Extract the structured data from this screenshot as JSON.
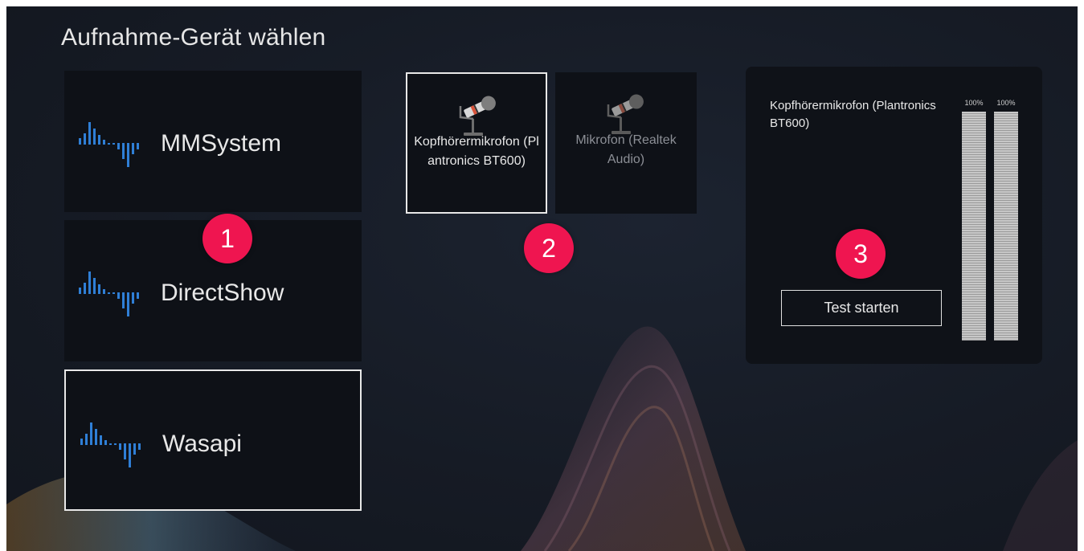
{
  "page": {
    "title": "Aufnahme-Gerät wählen"
  },
  "api_list": [
    {
      "label": "MMSystem",
      "selected": false,
      "icon": "audio-waveform-icon"
    },
    {
      "label": "DirectShow",
      "selected": false,
      "icon": "audio-waveform-icon"
    },
    {
      "label": "Wasapi",
      "selected": true,
      "icon": "audio-waveform-icon"
    }
  ],
  "devices": [
    {
      "label": "Kopfhörermikrofon (Plantronics BT600)",
      "selected": true,
      "icon": "microphone-icon"
    },
    {
      "label": "Mikrofon (Realtek Audio)",
      "selected": false,
      "icon": "microphone-icon"
    }
  ],
  "test_panel": {
    "device_name": "Kopfhörermikrofon (Plantronics BT600)",
    "button_label": "Test starten",
    "meters": [
      {
        "label": "100%",
        "level": 1.0
      },
      {
        "label": "100%",
        "level": 1.0
      }
    ]
  },
  "callouts": [
    "1",
    "2",
    "3"
  ],
  "colors": {
    "background": "#161b25",
    "card": "#0e1117",
    "accent_blue": "#2f7fd6",
    "badge": "#ef1550",
    "text": "#e8e8e8",
    "inactive_text": "#8c8f96"
  }
}
